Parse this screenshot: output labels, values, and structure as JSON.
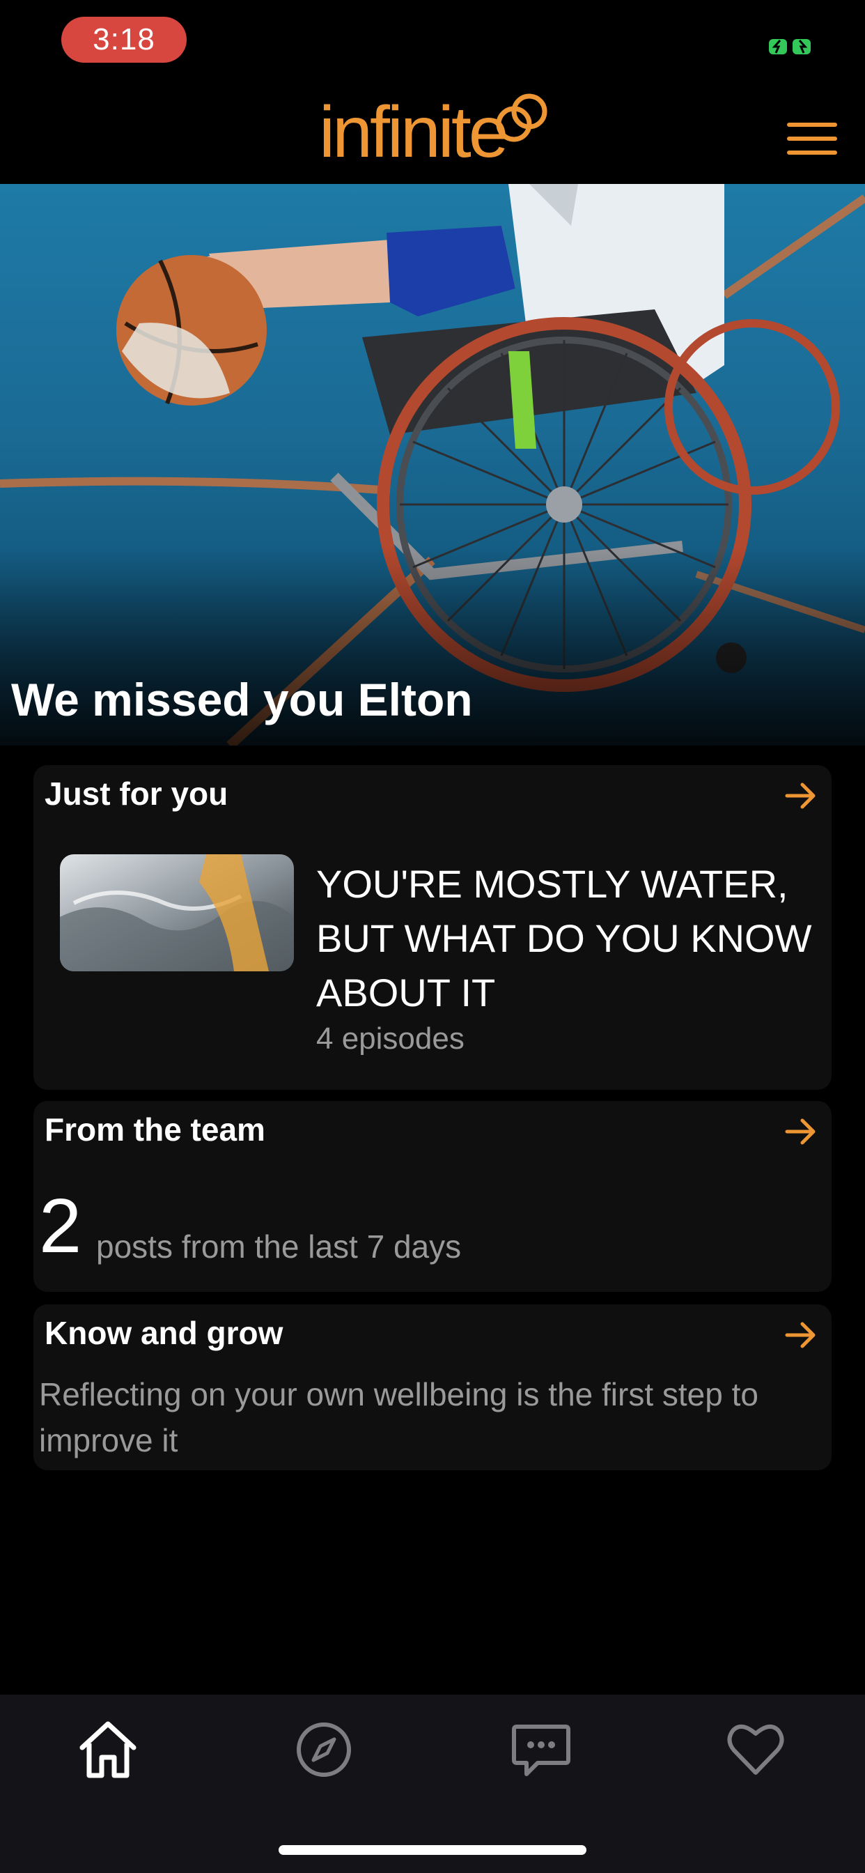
{
  "status_bar": {
    "time": "3:18"
  },
  "header": {
    "logo_text": "infinite",
    "menu_icon": "hamburger-menu-icon"
  },
  "hero": {
    "title": "We missed you Elton"
  },
  "just_for_you": {
    "title": "Just for you",
    "series_title": "YOU'RE MOSTLY WATER, BUT WHAT DO YOU KNOW ABOUT IT",
    "episodes": "4 episodes"
  },
  "from_the_team": {
    "title": "From the team",
    "count": "2",
    "count_label": "posts from the last 7 days"
  },
  "know_and_grow": {
    "title": "Know and grow",
    "body": "Reflecting on your own wellbeing is the first step to improve it"
  },
  "tabs": [
    {
      "icon": "home-icon",
      "active": true
    },
    {
      "icon": "compass-icon",
      "active": false
    },
    {
      "icon": "chat-icon",
      "active": false
    },
    {
      "icon": "heart-icon",
      "active": false
    }
  ],
  "colors": {
    "accent": "#ee9633",
    "status_pill": "#d7463f",
    "battery": "#34c759",
    "card": "#0f0f0f",
    "tabbar": "#141418"
  }
}
